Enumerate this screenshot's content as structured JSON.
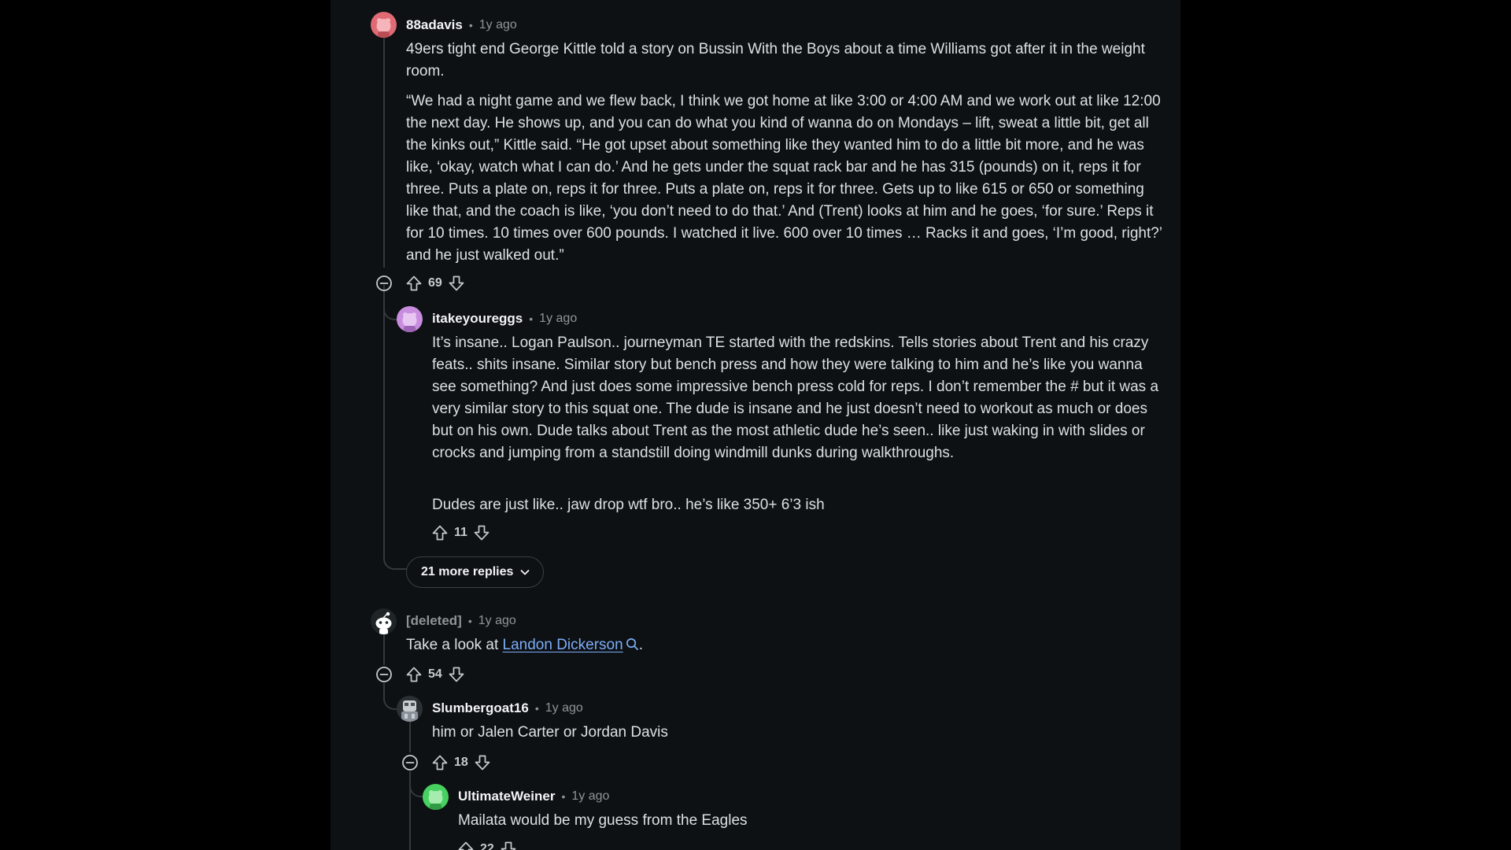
{
  "comments": [
    {
      "author": "88adavis",
      "time": "1y ago",
      "paragraphs": [
        "49ers tight end George Kittle told a story on Bussin With the Boys about a time Williams got after it in the weight room.",
        "“We had a night game and we flew back, I think we got home at like 3:00 or 4:00 AM and we work out at like 12:00 the next day. He shows up, and you can do what you kind of wanna do on Mondays – lift, sweat a little bit, get all the kinks out,” Kittle said. “He got upset about something like they wanted him to do a little bit more, and he was like, ‘okay, watch what I can do.’ And he gets under the squat rack bar and he has 315 (pounds) on it, reps it for three. Puts a plate on, reps it for three. Puts a plate on, reps it for three. Gets up to like 615 or 650 or something like that, and the coach is like, ‘you don’t need to do that.’ And (Trent) looks at him and he goes, ‘for sure.’ Reps it for 10 times. 10 times over 600 pounds. I watched it live. 600 over 10 times … Racks it and goes, ‘I’m good, right?’ and he just walked out.”"
      ],
      "score": "69",
      "avatar_color": "#e06b74"
    },
    {
      "author": "itakeyoureggs",
      "time": "1y ago",
      "paragraphs": [
        "It’s insane.. Logan Paulson.. journeyman TE started with the redskins. Tells stories about Trent and his crazy feats.. shits insane. Similar story but bench press and how they were talking to him and he’s like you wanna see something? And just does some impressive bench press cold for reps. I don’t remember the # but it was a very similar story to this squat one. The dude is insane and he just doesn’t need to workout as much or does but on his own. Dude talks about Trent as the most athletic dude he’s seen.. like just waking in with slides or crocks and jumping from a standstill doing windmill dunks during walkthroughs.",
        "Dudes are just like.. jaw drop wtf bro.. he’s like 350+ 6’3 ish"
      ],
      "score": "11",
      "avatar_color": "#c98de0"
    },
    {
      "author": "[deleted]",
      "time": "1y ago",
      "text_before": "Take a look at ",
      "link_text": "Landon Dickerson",
      "text_after": ".",
      "score": "54",
      "avatar_color": "#d9dcde"
    },
    {
      "author": "Slumbergoat16",
      "time": "1y ago",
      "paragraphs": [
        "him or Jalen Carter or Jordan Davis"
      ],
      "score": "18",
      "avatar_color": "#8a9098"
    },
    {
      "author": "UltimateWeiner",
      "time": "1y ago",
      "paragraphs": [
        "Mailata would be my guess from the Eagles"
      ],
      "score": "22",
      "avatar_color": "#46d160"
    }
  ],
  "more_replies": {
    "label": "21 more replies"
  },
  "icons": {
    "upvote": "upvote-icon",
    "downvote": "downvote-icon",
    "collapse": "collapse-thread-icon",
    "search": "search-icon",
    "chevron": "chevron-down-icon"
  },
  "colors": {
    "background": "#0e1113",
    "text": "#dbe0e3",
    "meta": "#8e9499",
    "link": "#7cacf8",
    "thread_line": "#33393c"
  }
}
